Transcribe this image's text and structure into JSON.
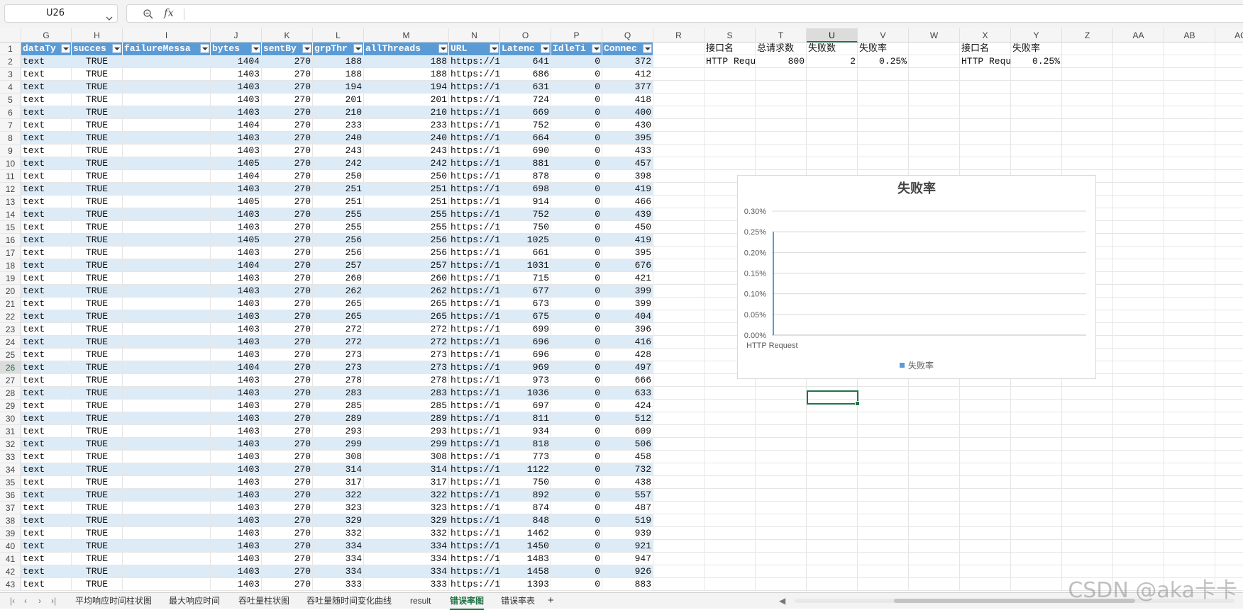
{
  "name_box": "U26",
  "formula": "",
  "columns": [
    "G",
    "H",
    "I",
    "J",
    "K",
    "L",
    "M",
    "N",
    "O",
    "P",
    "Q",
    "R",
    "S",
    "T",
    "U",
    "V",
    "W",
    "X",
    "Y",
    "Z",
    "AA",
    "AB",
    "AC"
  ],
  "selected_column": "U",
  "selected_row": "26",
  "table_headers": [
    "dataTy",
    "succes",
    "failureMessa",
    "bytes",
    "sentBy",
    "grpThr",
    "allThreads",
    "URL",
    "Latenc",
    "IdleTi",
    "Connec"
  ],
  "rows": [
    [
      "text",
      "TRUE",
      "",
      "1404",
      "270",
      "188",
      "188",
      "https://1",
      "641",
      "0",
      "372"
    ],
    [
      "text",
      "TRUE",
      "",
      "1403",
      "270",
      "188",
      "188",
      "https://1",
      "686",
      "0",
      "412"
    ],
    [
      "text",
      "TRUE",
      "",
      "1403",
      "270",
      "194",
      "194",
      "https://1",
      "631",
      "0",
      "377"
    ],
    [
      "text",
      "TRUE",
      "",
      "1403",
      "270",
      "201",
      "201",
      "https://1",
      "724",
      "0",
      "418"
    ],
    [
      "text",
      "TRUE",
      "",
      "1403",
      "270",
      "210",
      "210",
      "https://1",
      "669",
      "0",
      "400"
    ],
    [
      "text",
      "TRUE",
      "",
      "1404",
      "270",
      "233",
      "233",
      "https://1",
      "752",
      "0",
      "430"
    ],
    [
      "text",
      "TRUE",
      "",
      "1403",
      "270",
      "240",
      "240",
      "https://1",
      "664",
      "0",
      "395"
    ],
    [
      "text",
      "TRUE",
      "",
      "1403",
      "270",
      "243",
      "243",
      "https://1",
      "690",
      "0",
      "433"
    ],
    [
      "text",
      "TRUE",
      "",
      "1405",
      "270",
      "242",
      "242",
      "https://1",
      "881",
      "0",
      "457"
    ],
    [
      "text",
      "TRUE",
      "",
      "1404",
      "270",
      "250",
      "250",
      "https://1",
      "878",
      "0",
      "398"
    ],
    [
      "text",
      "TRUE",
      "",
      "1403",
      "270",
      "251",
      "251",
      "https://1",
      "698",
      "0",
      "419"
    ],
    [
      "text",
      "TRUE",
      "",
      "1405",
      "270",
      "251",
      "251",
      "https://1",
      "914",
      "0",
      "466"
    ],
    [
      "text",
      "TRUE",
      "",
      "1403",
      "270",
      "255",
      "255",
      "https://1",
      "752",
      "0",
      "439"
    ],
    [
      "text",
      "TRUE",
      "",
      "1403",
      "270",
      "255",
      "255",
      "https://1",
      "750",
      "0",
      "450"
    ],
    [
      "text",
      "TRUE",
      "",
      "1405",
      "270",
      "256",
      "256",
      "https://1",
      "1025",
      "0",
      "419"
    ],
    [
      "text",
      "TRUE",
      "",
      "1403",
      "270",
      "256",
      "256",
      "https://1",
      "661",
      "0",
      "395"
    ],
    [
      "text",
      "TRUE",
      "",
      "1404",
      "270",
      "257",
      "257",
      "https://1",
      "1031",
      "0",
      "676"
    ],
    [
      "text",
      "TRUE",
      "",
      "1403",
      "270",
      "260",
      "260",
      "https://1",
      "715",
      "0",
      "421"
    ],
    [
      "text",
      "TRUE",
      "",
      "1403",
      "270",
      "262",
      "262",
      "https://1",
      "677",
      "0",
      "399"
    ],
    [
      "text",
      "TRUE",
      "",
      "1403",
      "270",
      "265",
      "265",
      "https://1",
      "673",
      "0",
      "399"
    ],
    [
      "text",
      "TRUE",
      "",
      "1403",
      "270",
      "265",
      "265",
      "https://1",
      "675",
      "0",
      "404"
    ],
    [
      "text",
      "TRUE",
      "",
      "1403",
      "270",
      "272",
      "272",
      "https://1",
      "699",
      "0",
      "396"
    ],
    [
      "text",
      "TRUE",
      "",
      "1403",
      "270",
      "272",
      "272",
      "https://1",
      "696",
      "0",
      "416"
    ],
    [
      "text",
      "TRUE",
      "",
      "1403",
      "270",
      "273",
      "273",
      "https://1",
      "696",
      "0",
      "428"
    ],
    [
      "text",
      "TRUE",
      "",
      "1404",
      "270",
      "273",
      "273",
      "https://1",
      "969",
      "0",
      "497"
    ],
    [
      "text",
      "TRUE",
      "",
      "1403",
      "270",
      "278",
      "278",
      "https://1",
      "973",
      "0",
      "666"
    ],
    [
      "text",
      "TRUE",
      "",
      "1403",
      "270",
      "283",
      "283",
      "https://1",
      "1036",
      "0",
      "633"
    ],
    [
      "text",
      "TRUE",
      "",
      "1403",
      "270",
      "285",
      "285",
      "https://1",
      "697",
      "0",
      "424"
    ],
    [
      "text",
      "TRUE",
      "",
      "1403",
      "270",
      "289",
      "289",
      "https://1",
      "811",
      "0",
      "512"
    ],
    [
      "text",
      "TRUE",
      "",
      "1403",
      "270",
      "293",
      "293",
      "https://1",
      "934",
      "0",
      "609"
    ],
    [
      "text",
      "TRUE",
      "",
      "1403",
      "270",
      "299",
      "299",
      "https://1",
      "818",
      "0",
      "506"
    ],
    [
      "text",
      "TRUE",
      "",
      "1403",
      "270",
      "308",
      "308",
      "https://1",
      "773",
      "0",
      "458"
    ],
    [
      "text",
      "TRUE",
      "",
      "1403",
      "270",
      "314",
      "314",
      "https://1",
      "1122",
      "0",
      "732"
    ],
    [
      "text",
      "TRUE",
      "",
      "1403",
      "270",
      "317",
      "317",
      "https://1",
      "750",
      "0",
      "438"
    ],
    [
      "text",
      "TRUE",
      "",
      "1403",
      "270",
      "322",
      "322",
      "https://1",
      "892",
      "0",
      "557"
    ],
    [
      "text",
      "TRUE",
      "",
      "1403",
      "270",
      "323",
      "323",
      "https://1",
      "874",
      "0",
      "487"
    ],
    [
      "text",
      "TRUE",
      "",
      "1403",
      "270",
      "329",
      "329",
      "https://1",
      "848",
      "0",
      "519"
    ],
    [
      "text",
      "TRUE",
      "",
      "1403",
      "270",
      "332",
      "332",
      "https://1",
      "1462",
      "0",
      "939"
    ],
    [
      "text",
      "TRUE",
      "",
      "1403",
      "270",
      "334",
      "334",
      "https://1",
      "1450",
      "0",
      "921"
    ],
    [
      "text",
      "TRUE",
      "",
      "1403",
      "270",
      "334",
      "334",
      "https://1",
      "1483",
      "0",
      "947"
    ],
    [
      "text",
      "TRUE",
      "",
      "1403",
      "270",
      "334",
      "334",
      "https://1",
      "1458",
      "0",
      "926"
    ],
    [
      "text",
      "TRUE",
      "",
      "1403",
      "270",
      "333",
      "333",
      "https://1",
      "1393",
      "0",
      "883"
    ]
  ],
  "summary": {
    "headers": [
      "接口名",
      "总请求数",
      "失败数",
      "失败率"
    ],
    "values": [
      "HTTP Requ",
      "800",
      "2",
      "0.25%"
    ]
  },
  "summary2": {
    "headers": [
      "接口名",
      "失败率"
    ],
    "values": [
      "HTTP Requ",
      "0.25%"
    ]
  },
  "chart_data": {
    "type": "bar",
    "title": "失败率",
    "categories": [
      "HTTP Request"
    ],
    "series": [
      {
        "name": "失败率",
        "values": [
          0.0025
        ]
      }
    ],
    "ylim": [
      0,
      0.003
    ],
    "yticks": [
      "0.00%",
      "0.05%",
      "0.10%",
      "0.15%",
      "0.20%",
      "0.25%",
      "0.30%"
    ],
    "legend": "bottom",
    "grid": true,
    "color": "#5b9bd5"
  },
  "sheet_tabs": [
    "平均响应时间柱状图",
    "最大响应时间",
    "吞吐量柱状图",
    "吞吐量随时间变化曲线",
    "result",
    "错误率图",
    "错误率表"
  ],
  "active_tab": "错误率图",
  "add_tab": "+",
  "watermark": "CSDN @aka卡卡"
}
